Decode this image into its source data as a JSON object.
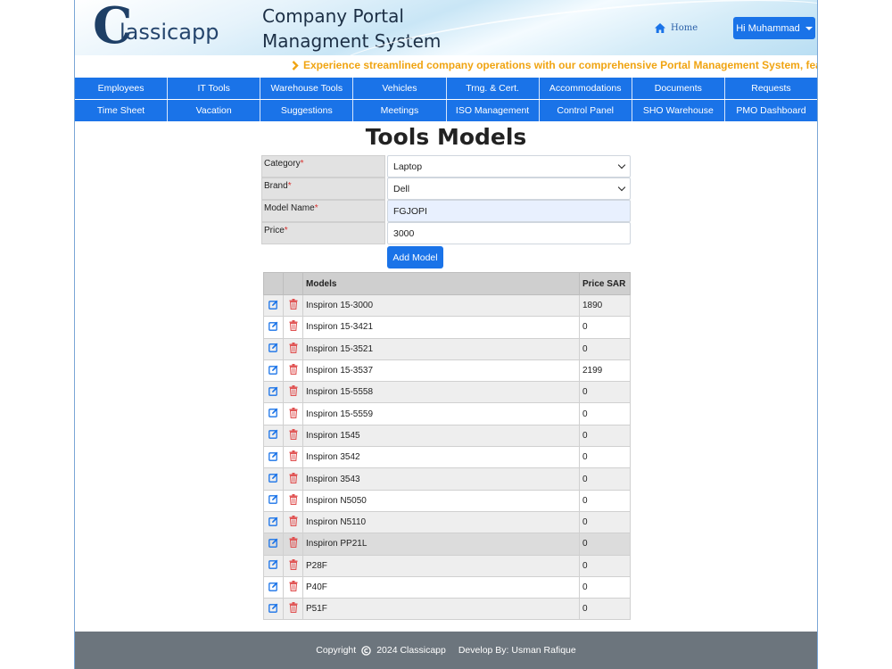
{
  "header": {
    "logo_letter": "C",
    "logo_text": "lassicapp",
    "title_line1": "Company Portal",
    "title_line2": "Managment System",
    "home_label": "Home",
    "user_label": "Hi Muhammad"
  },
  "marquee_text": "Experience streamlined company operations with our comprehensive Portal Management System, featur",
  "nav": {
    "row1": [
      "Employees",
      "IT Tools",
      "Warehouse Tools",
      "Vehicles",
      "Trng. & Cert.",
      "Accommodations",
      "Documents",
      "Requests"
    ],
    "row2": [
      "Time Sheet",
      "Vacation",
      "Suggestions",
      "Meetings",
      "ISO Management",
      "Control Panel",
      "SHO Warehouse",
      "PMO Dashboard"
    ]
  },
  "page_title": "Tools Models",
  "form": {
    "category_label": "Category",
    "category_value": "Laptop",
    "brand_label": "Brand",
    "brand_value": "Dell",
    "model_label": "Model Name",
    "model_value": "FGJOPI",
    "price_label": "Price",
    "price_value": "3000",
    "required_mark": "*",
    "add_button": "Add Model"
  },
  "table": {
    "headers": [
      "",
      "",
      "Models",
      "Price SAR"
    ],
    "rows": [
      {
        "model": "Inspiron 15-3000",
        "price": "1890"
      },
      {
        "model": "Inspiron 15-3421",
        "price": "0"
      },
      {
        "model": "Inspiron 15-3521",
        "price": "0"
      },
      {
        "model": "Inspiron 15-3537",
        "price": "2199"
      },
      {
        "model": "Inspiron 15-5558",
        "price": "0"
      },
      {
        "model": "Inspiron 15-5559",
        "price": "0"
      },
      {
        "model": "Inspiron 1545",
        "price": "0"
      },
      {
        "model": "Inspiron 3542",
        "price": "0"
      },
      {
        "model": "Inspiron 3543",
        "price": "0"
      },
      {
        "model": "Inspiron N5050",
        "price": "0"
      },
      {
        "model": "Inspiron N5110",
        "price": "0"
      },
      {
        "model": "Inspiron PP21L",
        "price": "0"
      },
      {
        "model": "P28F",
        "price": "0"
      },
      {
        "model": "P40F",
        "price": "0"
      },
      {
        "model": "P51F",
        "price": "0"
      }
    ]
  },
  "footer": {
    "copyright": "Copyright",
    "year_company": "2024 Classicapp",
    "developer": "Develop By:  Usman Rafique"
  },
  "colors": {
    "primary": "#1a73e8",
    "marquee": "#f0a412",
    "delete_icon": "#e05252",
    "edit_icon": "#1a73e8",
    "footer_bg": "#6c757d"
  },
  "icons": {
    "edit": "edit-icon",
    "delete": "trash-icon",
    "home": "home-icon",
    "marquee": "chevron-right-icon",
    "copyright": "copyright-icon"
  }
}
